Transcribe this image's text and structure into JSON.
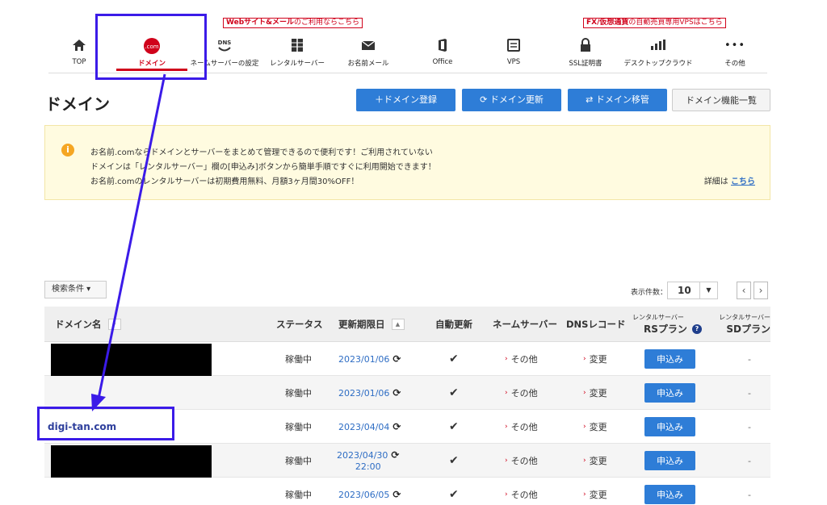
{
  "promos": {
    "web_mail": {
      "bold": "Webサイト&メール",
      "rest": "のご利用ならこちら"
    },
    "fx_vps": {
      "bold": "FX/仮想通貨",
      "rest": "の自動売買専用VPSはこちら"
    }
  },
  "nav": [
    {
      "label": "TOP",
      "icon": "home-icon"
    },
    {
      "label": "ドメイン",
      "icon": "dotcom-icon",
      "icon_text": ".com"
    },
    {
      "label": "ネームサーバーの設定",
      "icon": "dns-icon",
      "icon_text": "DNS"
    },
    {
      "label": "レンタルサーバー",
      "icon": "server-icon"
    },
    {
      "label": "お名前メール",
      "icon": "mail-icon"
    },
    {
      "label": "Office",
      "icon": "office-icon"
    },
    {
      "label": "VPS",
      "icon": "vps-icon"
    },
    {
      "label": "SSL証明書",
      "icon": "lock-icon"
    },
    {
      "label": "デスクトップクラウド",
      "icon": "cloud-icon"
    },
    {
      "label": "その他",
      "icon": "more-icon",
      "icon_text": "•••"
    }
  ],
  "page": {
    "title": "ドメイン",
    "buttons": {
      "register": "＋ドメイン登録",
      "renew": "⟳ ドメイン更新",
      "transfer": "⇄ ドメイン移管",
      "features": "ドメイン機能一覧"
    }
  },
  "notice": {
    "line1": "お名前.comならドメインとサーバーをまとめて管理できるので便利です！ご利用されていない",
    "line2": "ドメインは「レンタルサーバー」欄の[申込み]ボタンから簡単手順ですぐに利用開始できます！",
    "line3": "お名前.comのレンタルサーバーは初期費用無料、月額3ヶ月間30%OFF！",
    "more_prefix": "詳細は",
    "more_link": "こちら"
  },
  "filter": {
    "label": "検索条件 ▾",
    "per_page_label": "表示件数：",
    "per_page_value": "10"
  },
  "table": {
    "headers": {
      "domain": "ドメイン名",
      "status": "ステータス",
      "expiry": "更新期限日",
      "auto_renew": "自動更新",
      "nameserver": "ネームサーバー",
      "dns": "DNSレコード",
      "rs_small": "レンタルサーバー",
      "rs_plan": "RSプラン",
      "sd_small": "レンタルサーバー",
      "sd_plan": "SDプラン"
    },
    "rows": [
      {
        "domain": "",
        "status": "稼働中",
        "date": "2023/01/06",
        "ns": "その他",
        "dns": "変更",
        "apply": "申込み",
        "sd": "-"
      },
      {
        "domain": "",
        "status": "稼働中",
        "date": "2023/01/06",
        "ns": "その他",
        "dns": "変更",
        "apply": "申込み",
        "sd": "-"
      },
      {
        "domain": "digi-tan.com",
        "status": "稼働中",
        "date": "2023/04/04",
        "ns": "その他",
        "dns": "変更",
        "apply": "申込み",
        "sd": "-"
      },
      {
        "domain": "",
        "status": "稼働中",
        "date": "2023/04/30",
        "time": "22:00",
        "ns": "その他",
        "dns": "変更",
        "apply": "申込み",
        "sd": "-"
      },
      {
        "domain": "",
        "status": "稼働中",
        "date": "2023/06/05",
        "ns": "その他",
        "dns": "変更",
        "apply": "申込み",
        "sd": "-"
      }
    ]
  },
  "colors": {
    "accent_red": "#d0021b",
    "button_blue": "#2e7dd7",
    "annotation": "#3b1be8"
  }
}
